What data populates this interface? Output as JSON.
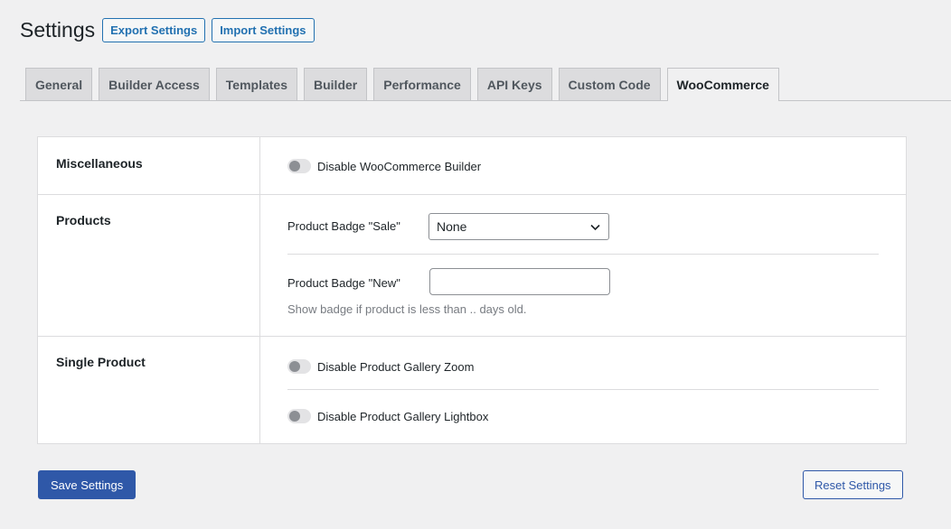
{
  "header": {
    "title": "Settings",
    "export_label": "Export Settings",
    "import_label": "Import Settings"
  },
  "tabs": [
    {
      "label": "General"
    },
    {
      "label": "Builder Access"
    },
    {
      "label": "Templates"
    },
    {
      "label": "Builder"
    },
    {
      "label": "Performance"
    },
    {
      "label": "API Keys"
    },
    {
      "label": "Custom Code"
    },
    {
      "label": "WooCommerce",
      "active": true
    }
  ],
  "sections": {
    "misc": {
      "label": "Miscellaneous",
      "disable_builder": {
        "label": "Disable WooCommerce Builder",
        "enabled": false
      }
    },
    "products": {
      "label": "Products",
      "badge_sale": {
        "label": "Product Badge \"Sale\"",
        "value": "None"
      },
      "badge_new": {
        "label": "Product Badge \"New\"",
        "value": "",
        "hint": "Show badge if product is less than .. days old."
      }
    },
    "single": {
      "label": "Single Product",
      "gallery_zoom": {
        "label": "Disable Product Gallery Zoom",
        "enabled": false
      },
      "gallery_lightbox": {
        "label": "Disable Product Gallery Lightbox",
        "enabled": false
      }
    }
  },
  "footer": {
    "save_label": "Save Settings",
    "reset_label": "Reset Settings"
  },
  "colors": {
    "accent": "#2f58a8",
    "toggle_off": "#e3e3e5",
    "background": "#f0f0f1"
  }
}
